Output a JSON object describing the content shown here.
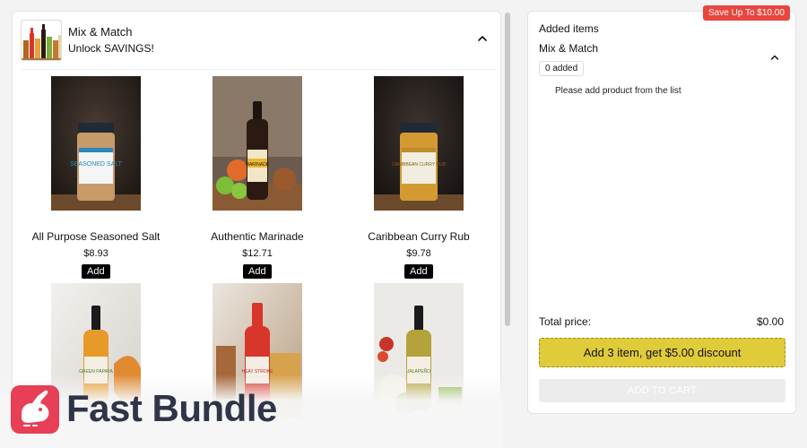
{
  "bundle": {
    "title": "Mix & Match",
    "subtitle": "Unlock SAVINGS!"
  },
  "products": [
    {
      "name": "All Purpose Seasoned Salt",
      "price": "$8.93",
      "add_label": "Add",
      "label_text": "SEASONED SALT"
    },
    {
      "name": "Authentic Marinade",
      "price": "$12.71",
      "add_label": "Add",
      "label_text": "MARINADE"
    },
    {
      "name": "Caribbean Curry Rub",
      "price": "$9.78",
      "add_label": "Add",
      "label_text": "CARIBBEAN CURRY RUB"
    },
    {
      "name": "",
      "price": "",
      "add_label": "",
      "label_text": "GREEN PAPAYA"
    },
    {
      "name": "",
      "price": "",
      "add_label": "",
      "label_text": "HEAT STROKE"
    },
    {
      "name": "",
      "price": "",
      "add_label": "",
      "label_text": "JALAPEÑO"
    }
  ],
  "summary": {
    "save_badge": "Save Up To $10.00",
    "added_title": "Added items",
    "group_title": "Mix & Match",
    "count": "0 added",
    "empty_message": "Please add product from the list",
    "total_label": "Total price:",
    "total_value": "$0.00",
    "discount_button": "Add 3 item, get $5.00 discount",
    "cart_button": "ADD TO CART"
  },
  "brand": {
    "name": "Fast Bundle"
  },
  "colors": {
    "accent_red": "#e8463f",
    "discount_yellow": "#e0cb3a",
    "brand_pink": "#e63f56",
    "brand_navy": "#2e3548"
  },
  "icons": {
    "collapse": "chevron-up-icon",
    "group_collapse": "chevron-up-icon",
    "brand": "rabbit-logo-icon"
  }
}
